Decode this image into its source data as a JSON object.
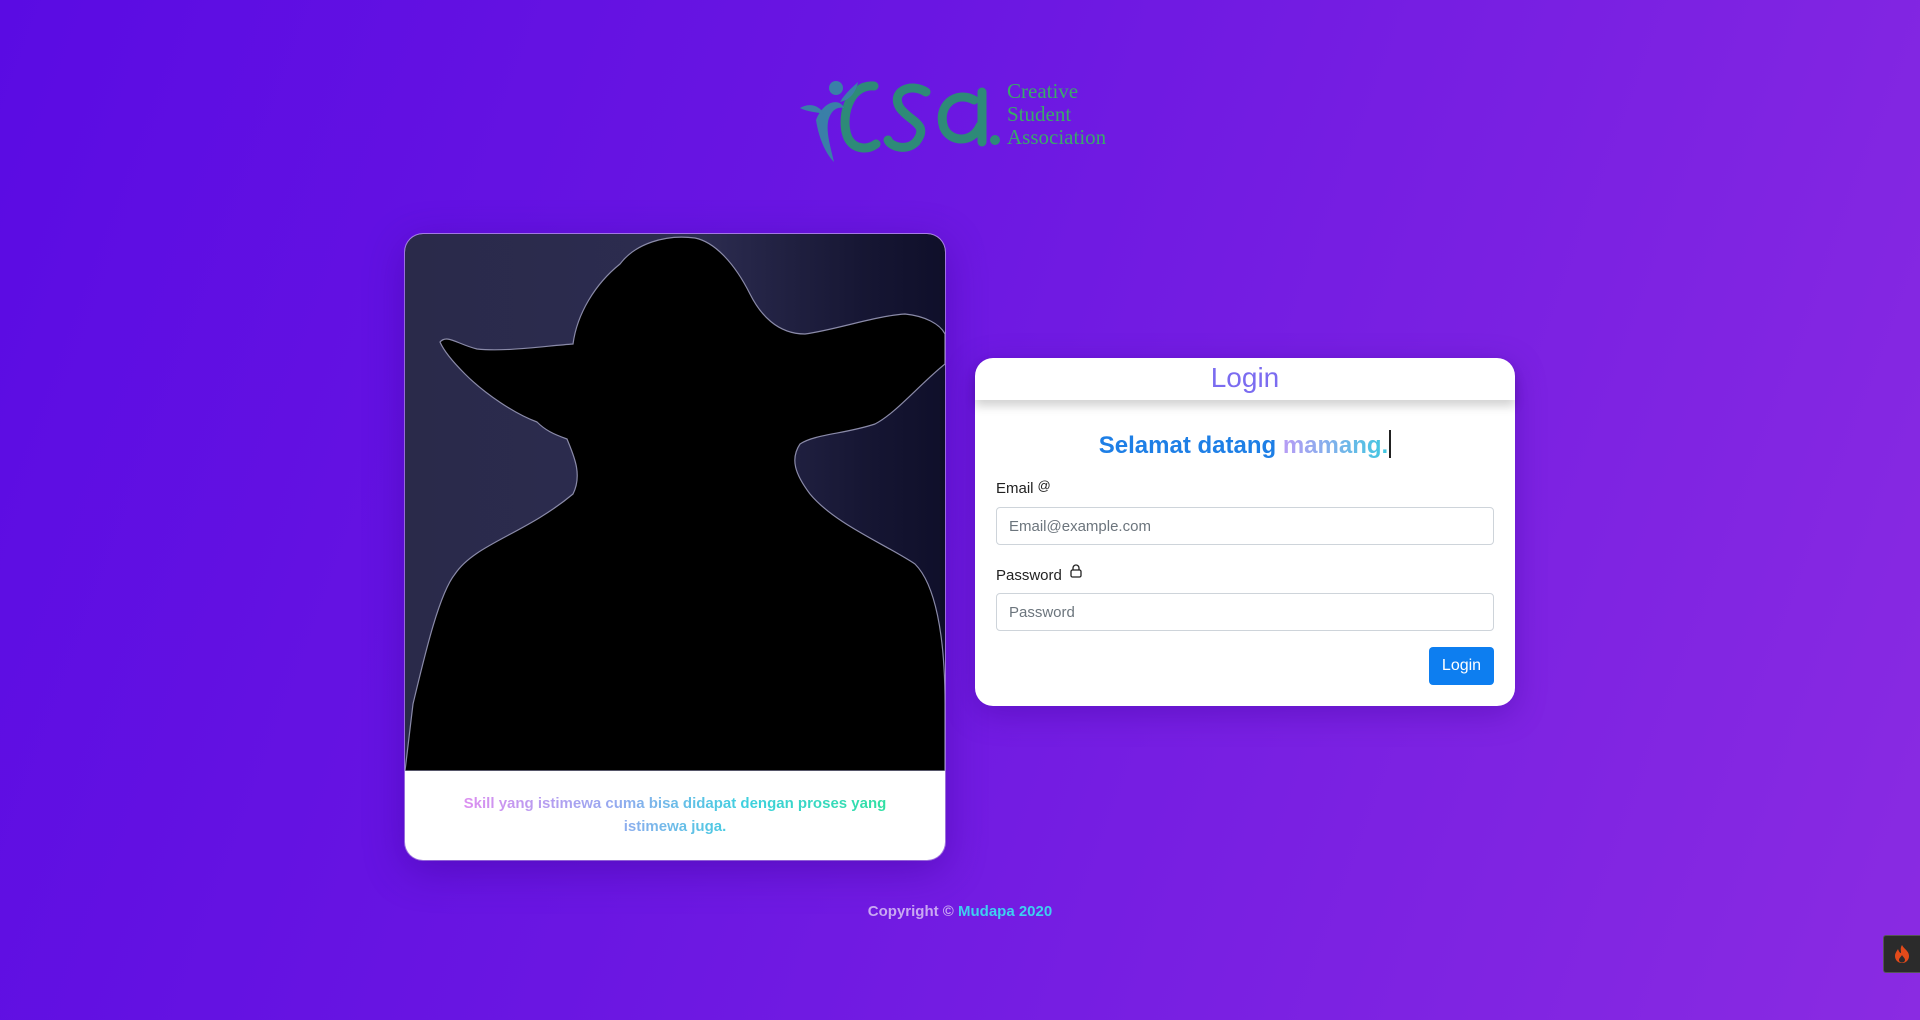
{
  "logo": {
    "lines": [
      "Creative",
      "Student",
      "Association"
    ],
    "icon": "csa-logo-icon"
  },
  "photo_card": {
    "image": "yoda-silhouette-photo",
    "quote": "Skill yang istimewa cuma bisa didapat dengan proses yang istimewa juga."
  },
  "login": {
    "title": "Login",
    "welcome_part1": "Selamat datang",
    "welcome_part2": "mamang.",
    "email_label": "Email",
    "email_icon": "at-icon",
    "email_placeholder": "Email@example.com",
    "password_label": "Password",
    "password_icon": "lock-icon",
    "password_placeholder": "Password",
    "submit_label": "Login"
  },
  "footer": {
    "prefix": "Copyright ©",
    "brand": "Mudapa 2020"
  },
  "debug_toolbar": {
    "icon": "flame-icon"
  },
  "colors": {
    "accent": "#0d7ef0",
    "title": "#7b6cf0",
    "background_start": "#5a0be3",
    "background_end": "#8a2be2"
  }
}
